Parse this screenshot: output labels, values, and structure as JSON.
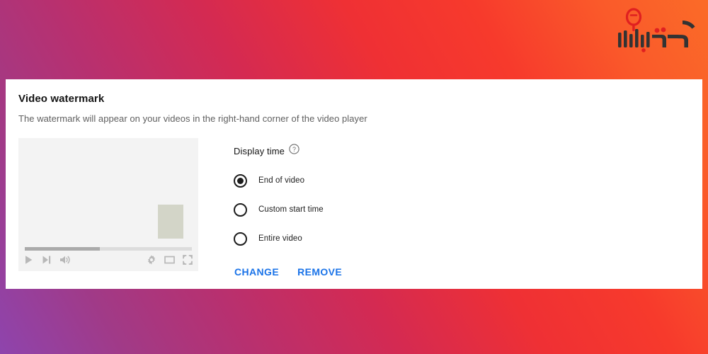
{
  "brand": {
    "name": "acharbaz-logo",
    "text": "آچارباز",
    "colors": {
      "dark": "#333333",
      "accent": "#e02020"
    }
  },
  "card": {
    "title": "Video watermark",
    "subtitle": "The watermark will appear on your videos in the right-hand corner of the video player"
  },
  "preview": {
    "name": "video-player-preview",
    "progress_percent": 45,
    "watermark_placeholder_color": "#d3d5c8",
    "controls": {
      "play": "play-icon",
      "next": "next-track-icon",
      "volume": "volume-icon",
      "settings": "gear-icon",
      "theater": "theater-mode-icon",
      "fullscreen": "fullscreen-icon"
    }
  },
  "options": {
    "section_label": "Display time",
    "help_icon": "help-circle-icon",
    "radios": [
      {
        "label": "End of video",
        "checked": true
      },
      {
        "label": "Custom start time",
        "checked": false
      },
      {
        "label": "Entire video",
        "checked": false
      }
    ]
  },
  "actions": {
    "change_label": "CHANGE",
    "remove_label": "REMOVE",
    "link_color": "#1a73e8"
  }
}
